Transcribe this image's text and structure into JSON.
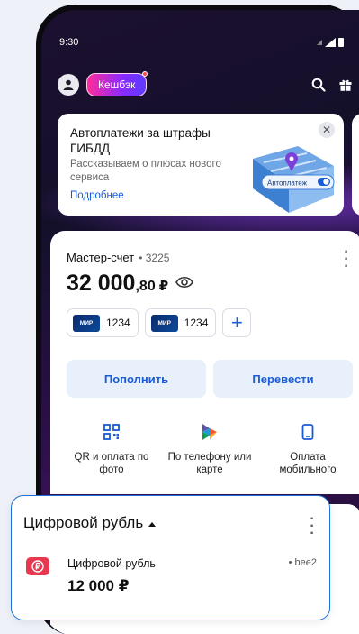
{
  "status_bar": {
    "time": "9:30"
  },
  "header": {
    "cashback_label": "Кешбэк"
  },
  "promo": {
    "title": "Автоплатежи за штрафы ГИБДД",
    "subtitle": "Рассказываем о плюсах нового сервиса",
    "link": "Подробнее",
    "art_label": "Автоплатеж"
  },
  "account": {
    "name": "Мастер-счет",
    "number": "• 3225",
    "balance_int": "32 000",
    "balance_frac": ",80",
    "currency": "₽",
    "cards": [
      {
        "brand": "МИР",
        "last4": "1234"
      },
      {
        "brand": "МИР",
        "last4": "1234"
      }
    ],
    "actions": {
      "topup": "Пополнить",
      "transfer": "Перевести"
    },
    "quick": [
      {
        "icon": "qr-icon",
        "label": "QR и оплата по фото"
      },
      {
        "icon": "sbp-icon",
        "label": "По телефону или карте"
      },
      {
        "icon": "phone-icon",
        "label": "Оплата мобильного"
      }
    ]
  },
  "digital_ruble": {
    "title": "Цифровой рубль",
    "account_name": "Цифровой рубль",
    "tag": "• bee2",
    "amount": "12 000 ₽"
  },
  "colors": {
    "accent": "#1a5bd6",
    "highlight_border": "#1a6fd8",
    "ruble_icon": "#e8384f"
  }
}
